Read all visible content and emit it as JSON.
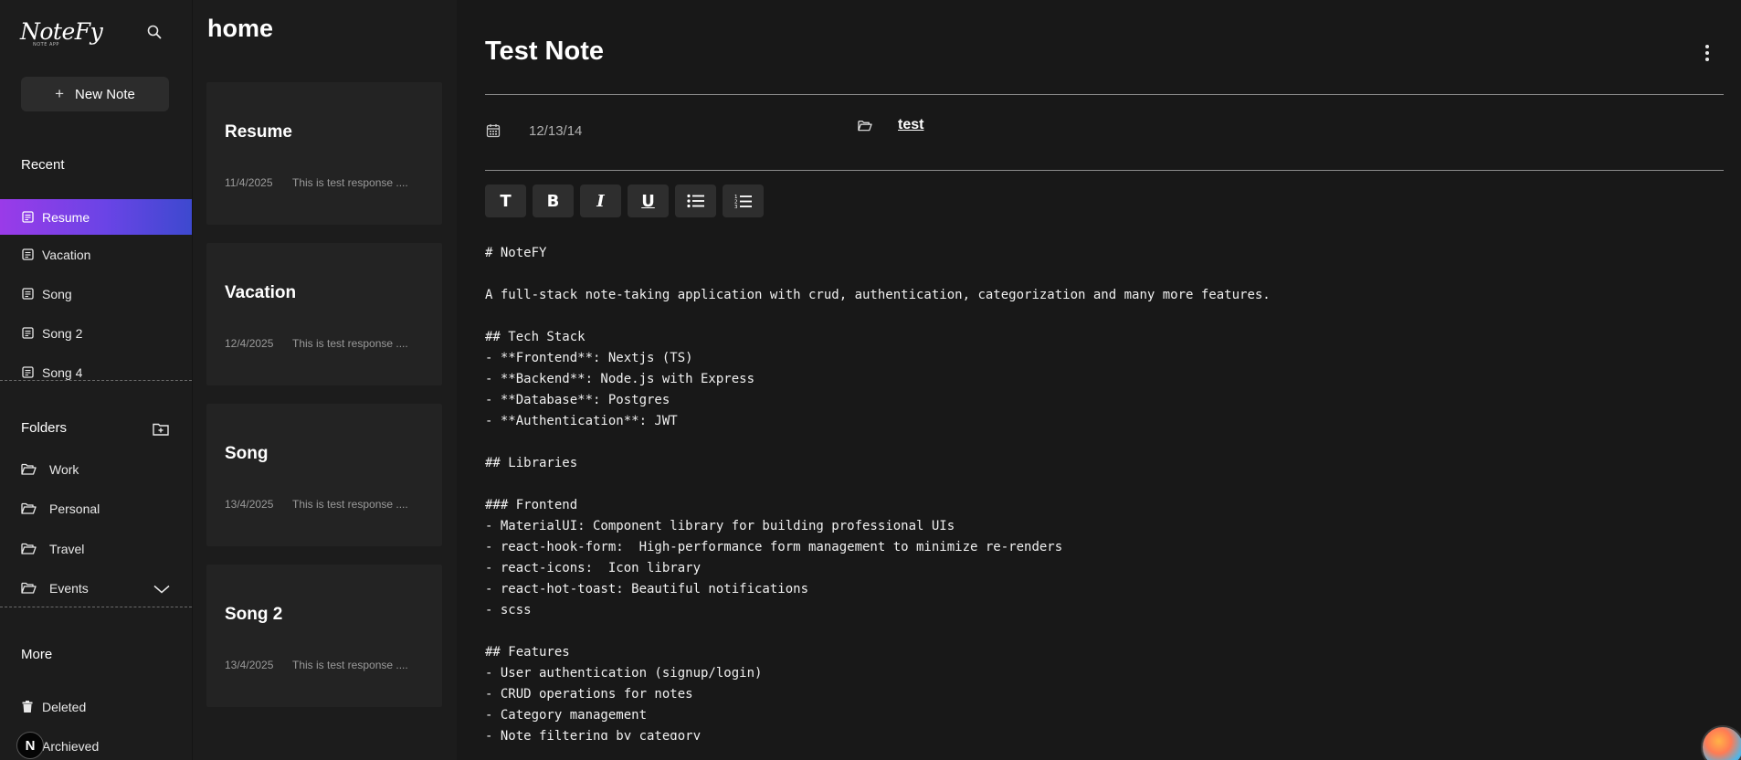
{
  "app": {
    "logo_text": "NoteFy",
    "logo_tag": "NOTE APP",
    "new_note_label": "New Note"
  },
  "sidebar": {
    "recent_title": "Recent",
    "recent_items": [
      {
        "label": "Resume",
        "active": true
      },
      {
        "label": "Vacation",
        "active": false
      },
      {
        "label": "Song",
        "active": false
      },
      {
        "label": "Song 2",
        "active": false
      },
      {
        "label": "Song 4",
        "active": false
      }
    ],
    "folders_title": "Folders",
    "folders": [
      {
        "label": "Work"
      },
      {
        "label": "Personal"
      },
      {
        "label": "Travel"
      },
      {
        "label": "Events"
      }
    ],
    "more_title": "More",
    "more_items": [
      {
        "label": "Deleted"
      },
      {
        "label": "Archieved"
      }
    ],
    "badge": "N"
  },
  "notes_panel": {
    "heading": "home",
    "notes": [
      {
        "title": "Resume",
        "date": "11/4/2025",
        "preview": "This is test response ...."
      },
      {
        "title": "Vacation",
        "date": "12/4/2025",
        "preview": "This is test response ...."
      },
      {
        "title": "Song",
        "date": "13/4/2025",
        "preview": "This is test response ...."
      },
      {
        "title": "Song 2",
        "date": "13/4/2025",
        "preview": "This is test response ...."
      }
    ]
  },
  "editor": {
    "title": "Test Note",
    "date": "12/13/14",
    "folder": "test",
    "toolbar": [
      "heading",
      "bold",
      "italic",
      "underline",
      "bulleted-list",
      "numbered-list"
    ],
    "content": "# NoteFY\n\nA full-stack note-taking application with crud, authentication, categorization and many more features.\n\n## Tech Stack\n- **Frontend**: Nextjs (TS)\n- **Backend**: Node.js with Express\n- **Database**: Postgres\n- **Authentication**: JWT\n\n## Libraries\n\n### Frontend\n- MaterialUI: Component library for building professional UIs\n- react-hook-form:  High-performance form management to minimize re-renders\n- react-icons:  Icon library\n- react-hot-toast: Beautiful notifications\n- scss\n\n## Features\n- User authentication (signup/login)\n- CRUD operations for notes\n- Category management\n- Note filtering by category"
  },
  "colors": {
    "accent_start": "#9a3be8",
    "accent_end": "#3d49cf",
    "background": "#181818",
    "panel": "#1c1c1c",
    "card": "#232323"
  }
}
